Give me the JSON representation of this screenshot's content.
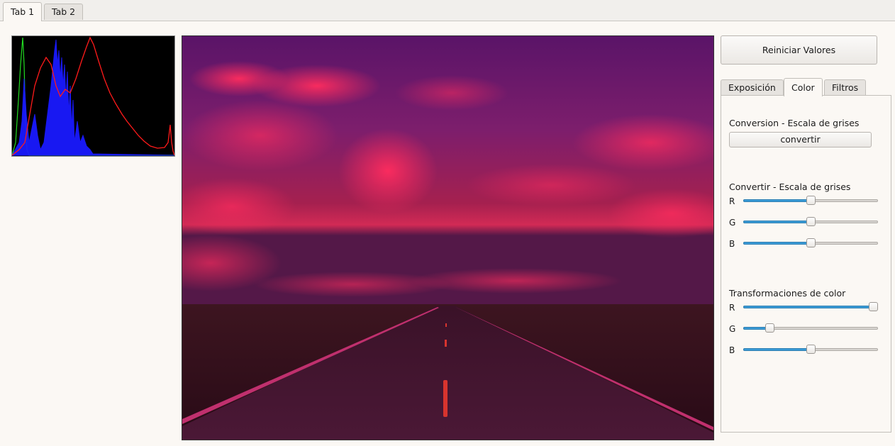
{
  "top_tabs": [
    {
      "label": "Tab 1",
      "active": true
    },
    {
      "label": "Tab 2",
      "active": false
    }
  ],
  "reset_button": "Reiniciar Valores",
  "inner_tabs": [
    {
      "label": "Exposición",
      "active": false
    },
    {
      "label": "Color",
      "active": true
    },
    {
      "label": "Filtros",
      "active": false
    }
  ],
  "color_panel": {
    "section1_title": "Conversion - Escala de grises",
    "convert_button": "convertir",
    "section2_title": "Convertir - Escala de grises",
    "section2_sliders": [
      {
        "channel": "R",
        "value": 0.5
      },
      {
        "channel": "G",
        "value": 0.5
      },
      {
        "channel": "B",
        "value": 0.5
      }
    ],
    "section3_title": "Transformaciones de color",
    "section3_sliders": [
      {
        "channel": "R",
        "value": 1.0
      },
      {
        "channel": "G",
        "value": 0.17
      },
      {
        "channel": "B",
        "value": 0.5
      }
    ]
  },
  "colors": {
    "accent": "#3a9bd6",
    "hist_red": "#ff1a1a",
    "hist_green": "#22dd22",
    "hist_blue": "#1a1aff"
  }
}
